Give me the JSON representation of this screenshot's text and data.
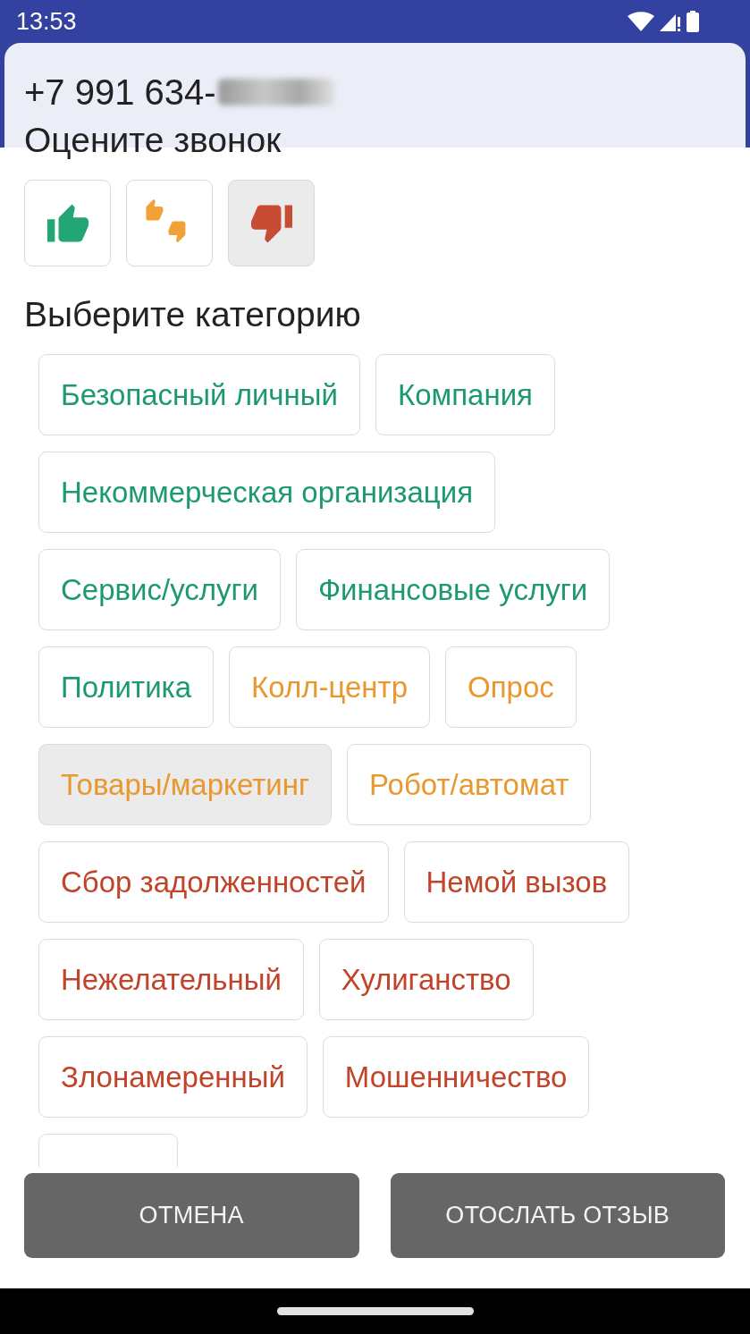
{
  "status_bar": {
    "time": "13:53"
  },
  "dialog": {
    "phone": {
      "text": "+7 991 634-",
      "redacted": true
    },
    "rating_title": "Оцените звонок",
    "rating_options": [
      {
        "kind": "like",
        "selected": false
      },
      {
        "kind": "neutral",
        "selected": false
      },
      {
        "kind": "dislike",
        "selected": true
      }
    ],
    "category_title": "Выберите категорию",
    "categories": [
      {
        "label": "Безопасный личный",
        "color": "#1c9a6c",
        "selected": false
      },
      {
        "label": "Компания",
        "color": "#1c9a6c",
        "selected": false
      },
      {
        "label": "Некоммерческая организация",
        "color": "#1c9a6c",
        "selected": false
      },
      {
        "label": "Сервис/услуги",
        "color": "#1c9a6c",
        "selected": false
      },
      {
        "label": "Финансовые услуги",
        "color": "#1c9a6c",
        "selected": false
      },
      {
        "label": "Политика",
        "color": "#1c9a6c",
        "selected": false
      },
      {
        "label": "Колл-центр",
        "color": "#e8982e",
        "selected": false
      },
      {
        "label": "Опрос",
        "color": "#e8982e",
        "selected": false
      },
      {
        "label": "Товары/маркетинг",
        "color": "#e8982e",
        "selected": true
      },
      {
        "label": "Робот/автомат",
        "color": "#e8982e",
        "selected": false
      },
      {
        "label": "Сбор задолженностей",
        "color": "#c0432a",
        "selected": false
      },
      {
        "label": "Немой вызов",
        "color": "#c0432a",
        "selected": false
      },
      {
        "label": "Нежелательный",
        "color": "#c0432a",
        "selected": false
      },
      {
        "label": "Хулиганство",
        "color": "#c0432a",
        "selected": false
      },
      {
        "label": "Злонамеренный",
        "color": "#c0432a",
        "selected": false
      },
      {
        "label": "Мошенничество",
        "color": "#c0432a",
        "selected": false
      },
      {
        "selected": false
      }
    ],
    "buttons": [
      "ОТМЕНА",
      "ОТОСЛАТЬ ОТЗЫВ"
    ]
  }
}
